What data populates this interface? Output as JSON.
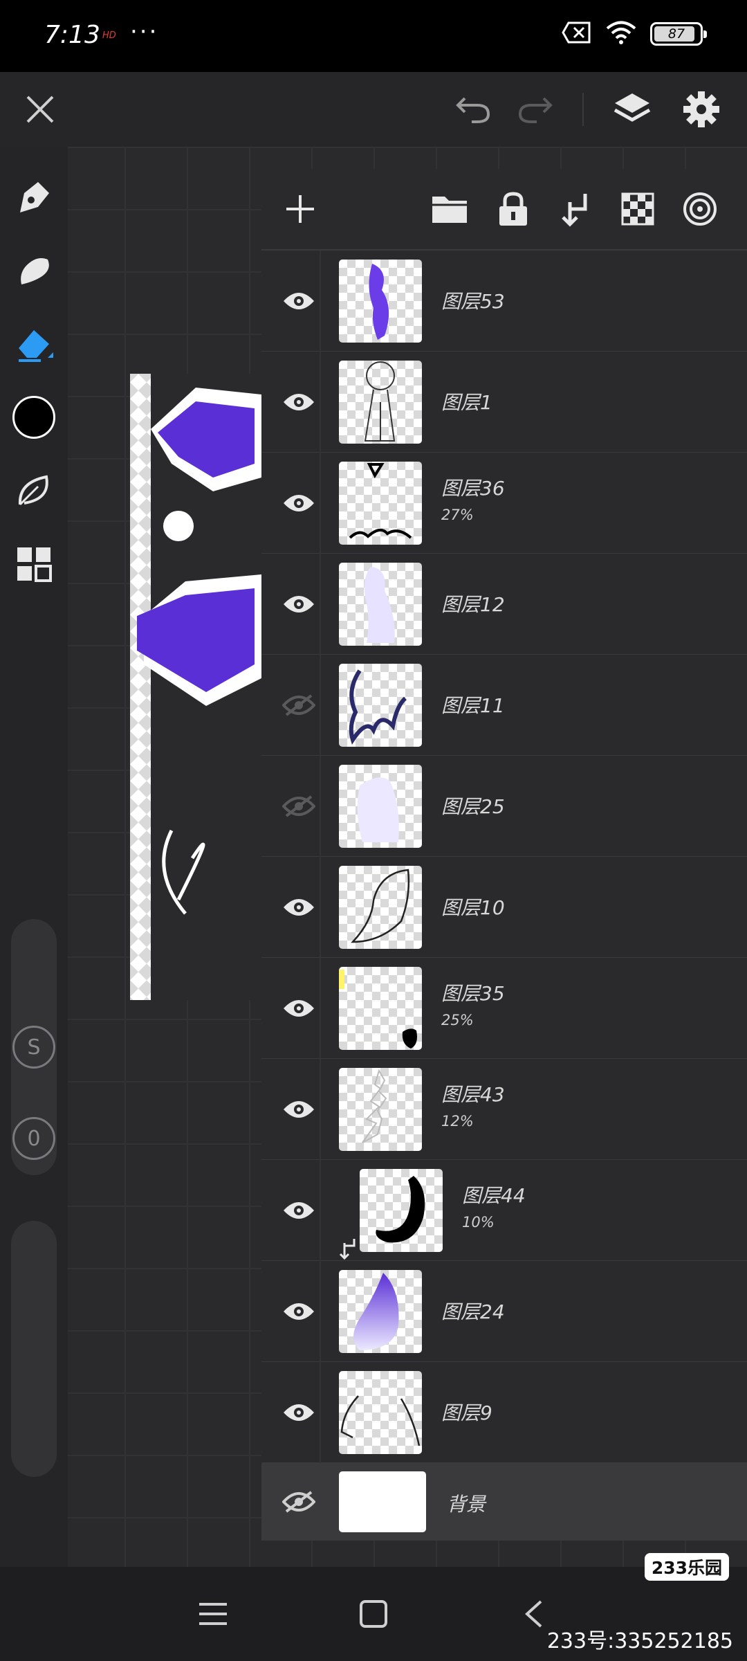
{
  "status_bar": {
    "time": "7:13",
    "tag": "HD",
    "dots": "···",
    "battery": "87"
  },
  "top_toolbar": {
    "close_icon": "close-icon",
    "undo_icon": "undo-icon",
    "redo_icon": "redo-icon",
    "layers_icon": "layers-icon",
    "settings_icon": "gear-icon"
  },
  "tool_rail": {
    "tools": [
      "pen-icon",
      "smudge-icon",
      "eraser-icon",
      "color-swatch",
      "leaf-icon",
      "grid-icon"
    ],
    "active_tool": "eraser",
    "brush_color": "#000000",
    "size_slider_label": "S",
    "opacity_slider_label": "0"
  },
  "layers_panel": {
    "toolbar_icons": [
      "add-icon",
      "folder-icon",
      "lock-icon",
      "merge-down-icon",
      "transparency-icon",
      "target-icon"
    ],
    "layers": [
      {
        "name": "图层53",
        "opacity": "",
        "visible": true,
        "clipped": false
      },
      {
        "name": "图层1",
        "opacity": "",
        "visible": true,
        "clipped": false
      },
      {
        "name": "图层36",
        "opacity": "27%",
        "visible": true,
        "clipped": false
      },
      {
        "name": "图层12",
        "opacity": "",
        "visible": true,
        "clipped": false
      },
      {
        "name": "图层11",
        "opacity": "",
        "visible": false,
        "clipped": false
      },
      {
        "name": "图层25",
        "opacity": "",
        "visible": false,
        "clipped": false
      },
      {
        "name": "图层10",
        "opacity": "",
        "visible": true,
        "clipped": false
      },
      {
        "name": "图层35",
        "opacity": "25%",
        "visible": true,
        "clipped": false
      },
      {
        "name": "图层43",
        "opacity": "12%",
        "visible": true,
        "clipped": false
      },
      {
        "name": "图层44",
        "opacity": "10%",
        "visible": true,
        "clipped": true
      },
      {
        "name": "图层24",
        "opacity": "",
        "visible": true,
        "clipped": false
      },
      {
        "name": "图层9",
        "opacity": "",
        "visible": true,
        "clipped": false
      }
    ],
    "background_layer": {
      "name": "背景",
      "visible": false
    }
  },
  "nav_bar": {
    "menu_icon": "menu-icon",
    "home_icon": "home-icon",
    "back_icon": "back-icon"
  },
  "watermark": {
    "logo": "233乐园",
    "text": "233号:335252185"
  },
  "colors": {
    "accent": "#2b9bf4",
    "panel": "#2a2a2c",
    "purple": "#5a2fd6"
  }
}
